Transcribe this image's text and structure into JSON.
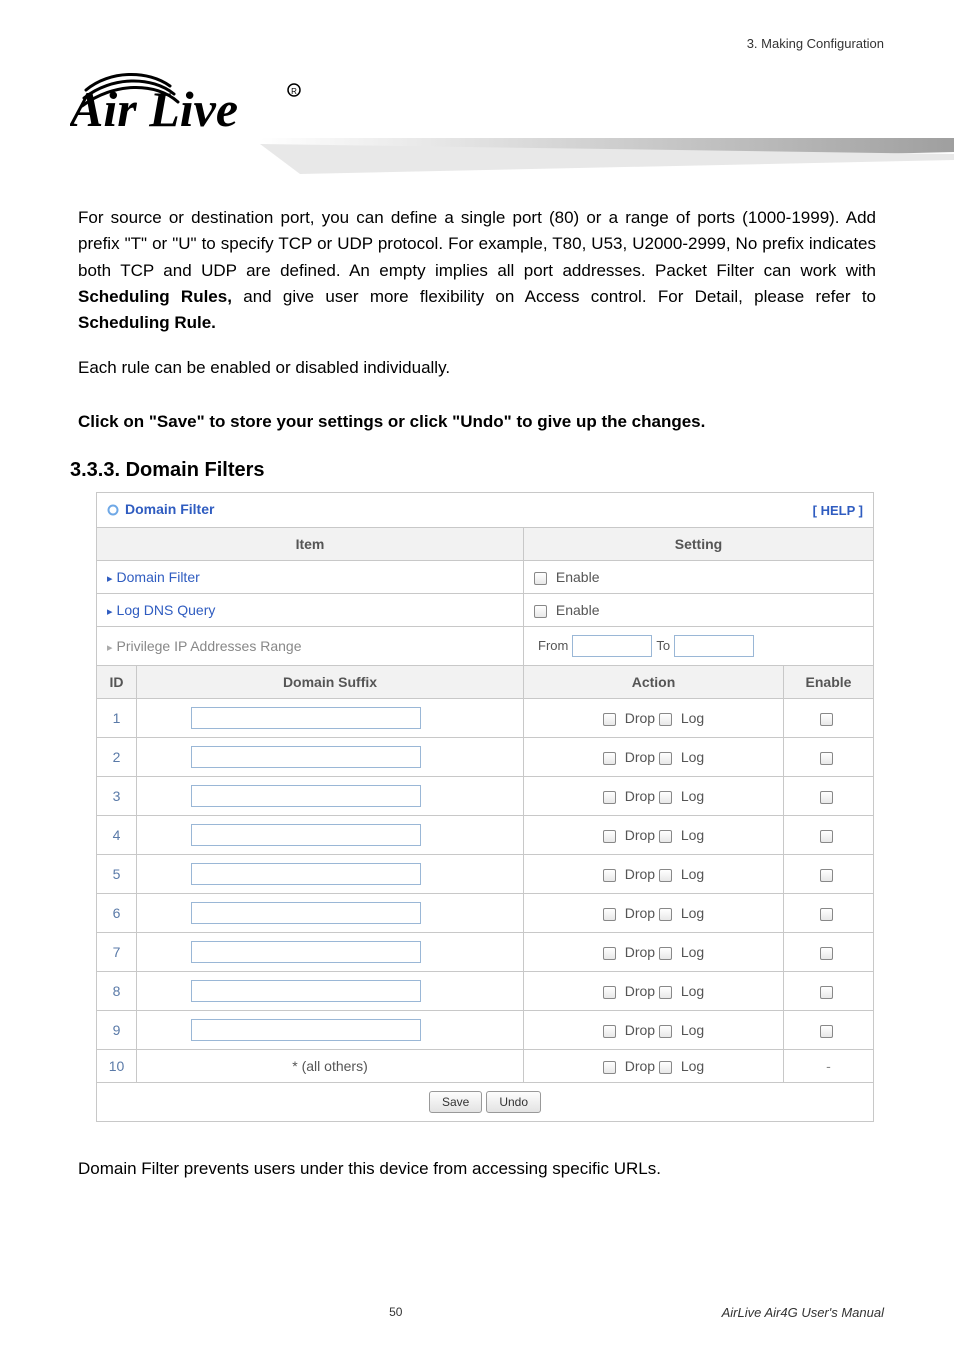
{
  "header": {
    "right": "3. Making Configuration"
  },
  "para1_pre": "For source or destination port, you can define a single port (80) or a range of ports (1000-1999). Add prefix \"T\" or \"U\" to specify TCP or UDP protocol. For example, T80, U53, U2000-2999, No prefix indicates both TCP and UDP are defined. An empty implies all port addresses. Packet Filter can work with ",
  "para1_b1": "Scheduling Rules,",
  "para1_mid": " and give user more flexibility on Access control. For Detail, please refer to ",
  "para1_b2": "Scheduling Rule.",
  "para2": "Each rule can be enabled or disabled individually.",
  "para3": "Click on \"Save\" to store your settings or click \"Undo\" to give up the changes.",
  "section_heading": "3.3.3.  Domain Filters",
  "table": {
    "title": "Domain Filter",
    "help": "[ HELP ]",
    "head_item": "Item",
    "head_setting": "Setting",
    "rows_setting": [
      {
        "label": "Domain Filter",
        "grey": false,
        "setting_type": "enable",
        "enable_label": "Enable"
      },
      {
        "label": "Log DNS Query",
        "grey": false,
        "setting_type": "enable",
        "enable_label": "Enable"
      },
      {
        "label": "Privilege IP Addresses Range",
        "grey": true,
        "setting_type": "range",
        "from_label": "From",
        "to_label": "To"
      }
    ],
    "grid_head": {
      "id": "ID",
      "suffix": "Domain Suffix",
      "action": "Action",
      "enable": "Enable"
    },
    "action_drop": "Drop",
    "action_log": "Log",
    "rows_grid": [
      {
        "id": "1",
        "suffix": "",
        "last": false
      },
      {
        "id": "2",
        "suffix": "",
        "last": false
      },
      {
        "id": "3",
        "suffix": "",
        "last": false
      },
      {
        "id": "4",
        "suffix": "",
        "last": false
      },
      {
        "id": "5",
        "suffix": "",
        "last": false
      },
      {
        "id": "6",
        "suffix": "",
        "last": false
      },
      {
        "id": "7",
        "suffix": "",
        "last": false
      },
      {
        "id": "8",
        "suffix": "",
        "last": false
      },
      {
        "id": "9",
        "suffix": "",
        "last": false
      },
      {
        "id": "10",
        "suffix": "* (all others)",
        "last": true
      }
    ],
    "btn_save": "Save",
    "btn_undo": "Undo"
  },
  "para_bottom": "Domain Filter prevents users under this device from accessing specific URLs.",
  "footer": {
    "page": "50",
    "manual": "AirLive Air4G User's Manual"
  }
}
